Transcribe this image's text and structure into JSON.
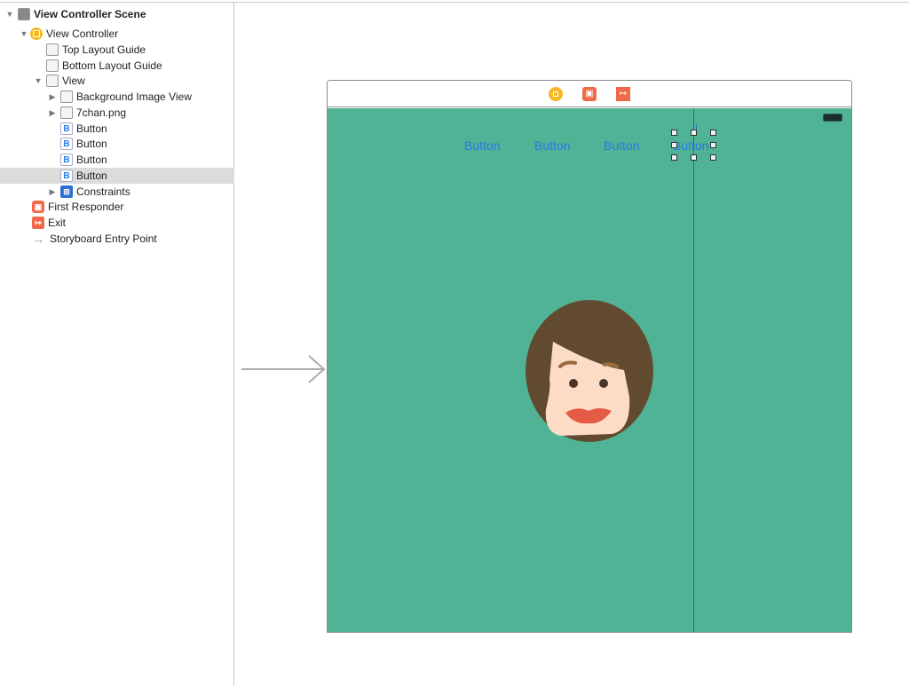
{
  "outline": {
    "scene": "View Controller Scene",
    "items": [
      {
        "label": "View Controller",
        "icon": "view-controller-icon"
      },
      {
        "label": "Top Layout Guide",
        "icon": "layout-guide-icon"
      },
      {
        "label": "Bottom Layout Guide",
        "icon": "layout-guide-icon"
      },
      {
        "label": "View",
        "icon": "view-icon"
      },
      {
        "label": "Background Image View",
        "icon": "image-view-icon"
      },
      {
        "label": "7chan.png",
        "icon": "image-view-icon"
      },
      {
        "label": "Button",
        "icon": "button-icon",
        "glyph": "B"
      },
      {
        "label": "Button",
        "icon": "button-icon",
        "glyph": "B"
      },
      {
        "label": "Button",
        "icon": "button-icon",
        "glyph": "B"
      },
      {
        "label": "Button",
        "icon": "button-icon",
        "glyph": "B",
        "selected": true
      },
      {
        "label": "Constraints",
        "icon": "constraints-icon"
      },
      {
        "label": "First Responder",
        "icon": "first-responder-icon"
      },
      {
        "label": "Exit",
        "icon": "exit-icon"
      },
      {
        "label": "Storyboard Entry Point",
        "icon": "entry-arrow-icon"
      }
    ]
  },
  "canvas": {
    "buttons": [
      "Button",
      "Button",
      "Button",
      "Button"
    ],
    "background": "#50b395",
    "accent": "#2a7ae2"
  }
}
